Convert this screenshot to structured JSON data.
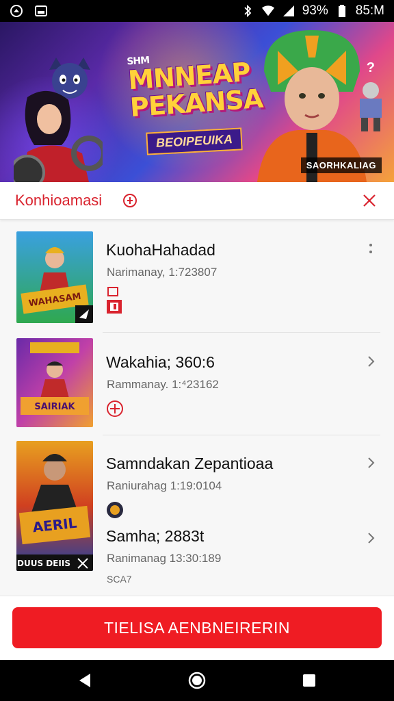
{
  "status_bar": {
    "battery": "93%",
    "time": "85:M",
    "icons": [
      "whatsapp-icon",
      "gallery-icon",
      "bluetooth-icon",
      "wifi-icon",
      "signal-icon",
      "battery-icon"
    ]
  },
  "banner": {
    "prefix": "SHM",
    "title_line1": "MNNEAP",
    "title_line2": "PEKANSA",
    "subtitle": "BEOIPEUIKA",
    "badge": "SAORHKALIAG"
  },
  "sheet": {
    "title": "Konhioamasi",
    "items": [
      {
        "title": "KuohaHahadad",
        "subtitle": "Narimanay, 1:723807",
        "thumb_caption": "WAHASAM",
        "thumb_colors": [
          "#2fa84f",
          "#e8b020",
          "#c02a2a"
        ]
      },
      {
        "title": "Wakahia; 360:6",
        "subtitle": "Rammanay. 1:⁴23162",
        "thumb_caption": "SAIRIAK",
        "thumb_colors": [
          "#6a2aa8",
          "#e84aa0",
          "#f0a030"
        ]
      },
      {
        "title": "Samndakan Zepantioaa",
        "subtitle": "Raniurahag 1:19:0104",
        "thumb_caption": "AERIL",
        "thumb_colors": [
          "#e8a020",
          "#b03020",
          "#3050b0"
        ]
      },
      {
        "title": "Samha; 2883t",
        "subtitle": "Ranimanag 13:30:189",
        "code": "SCA7",
        "thumb_caption": "DUUS DEIIS"
      }
    ],
    "cta_label": "TIELISA AENBNEIRERIN"
  },
  "colors": {
    "accent": "#ef1c23",
    "title_red": "#d9232e"
  }
}
